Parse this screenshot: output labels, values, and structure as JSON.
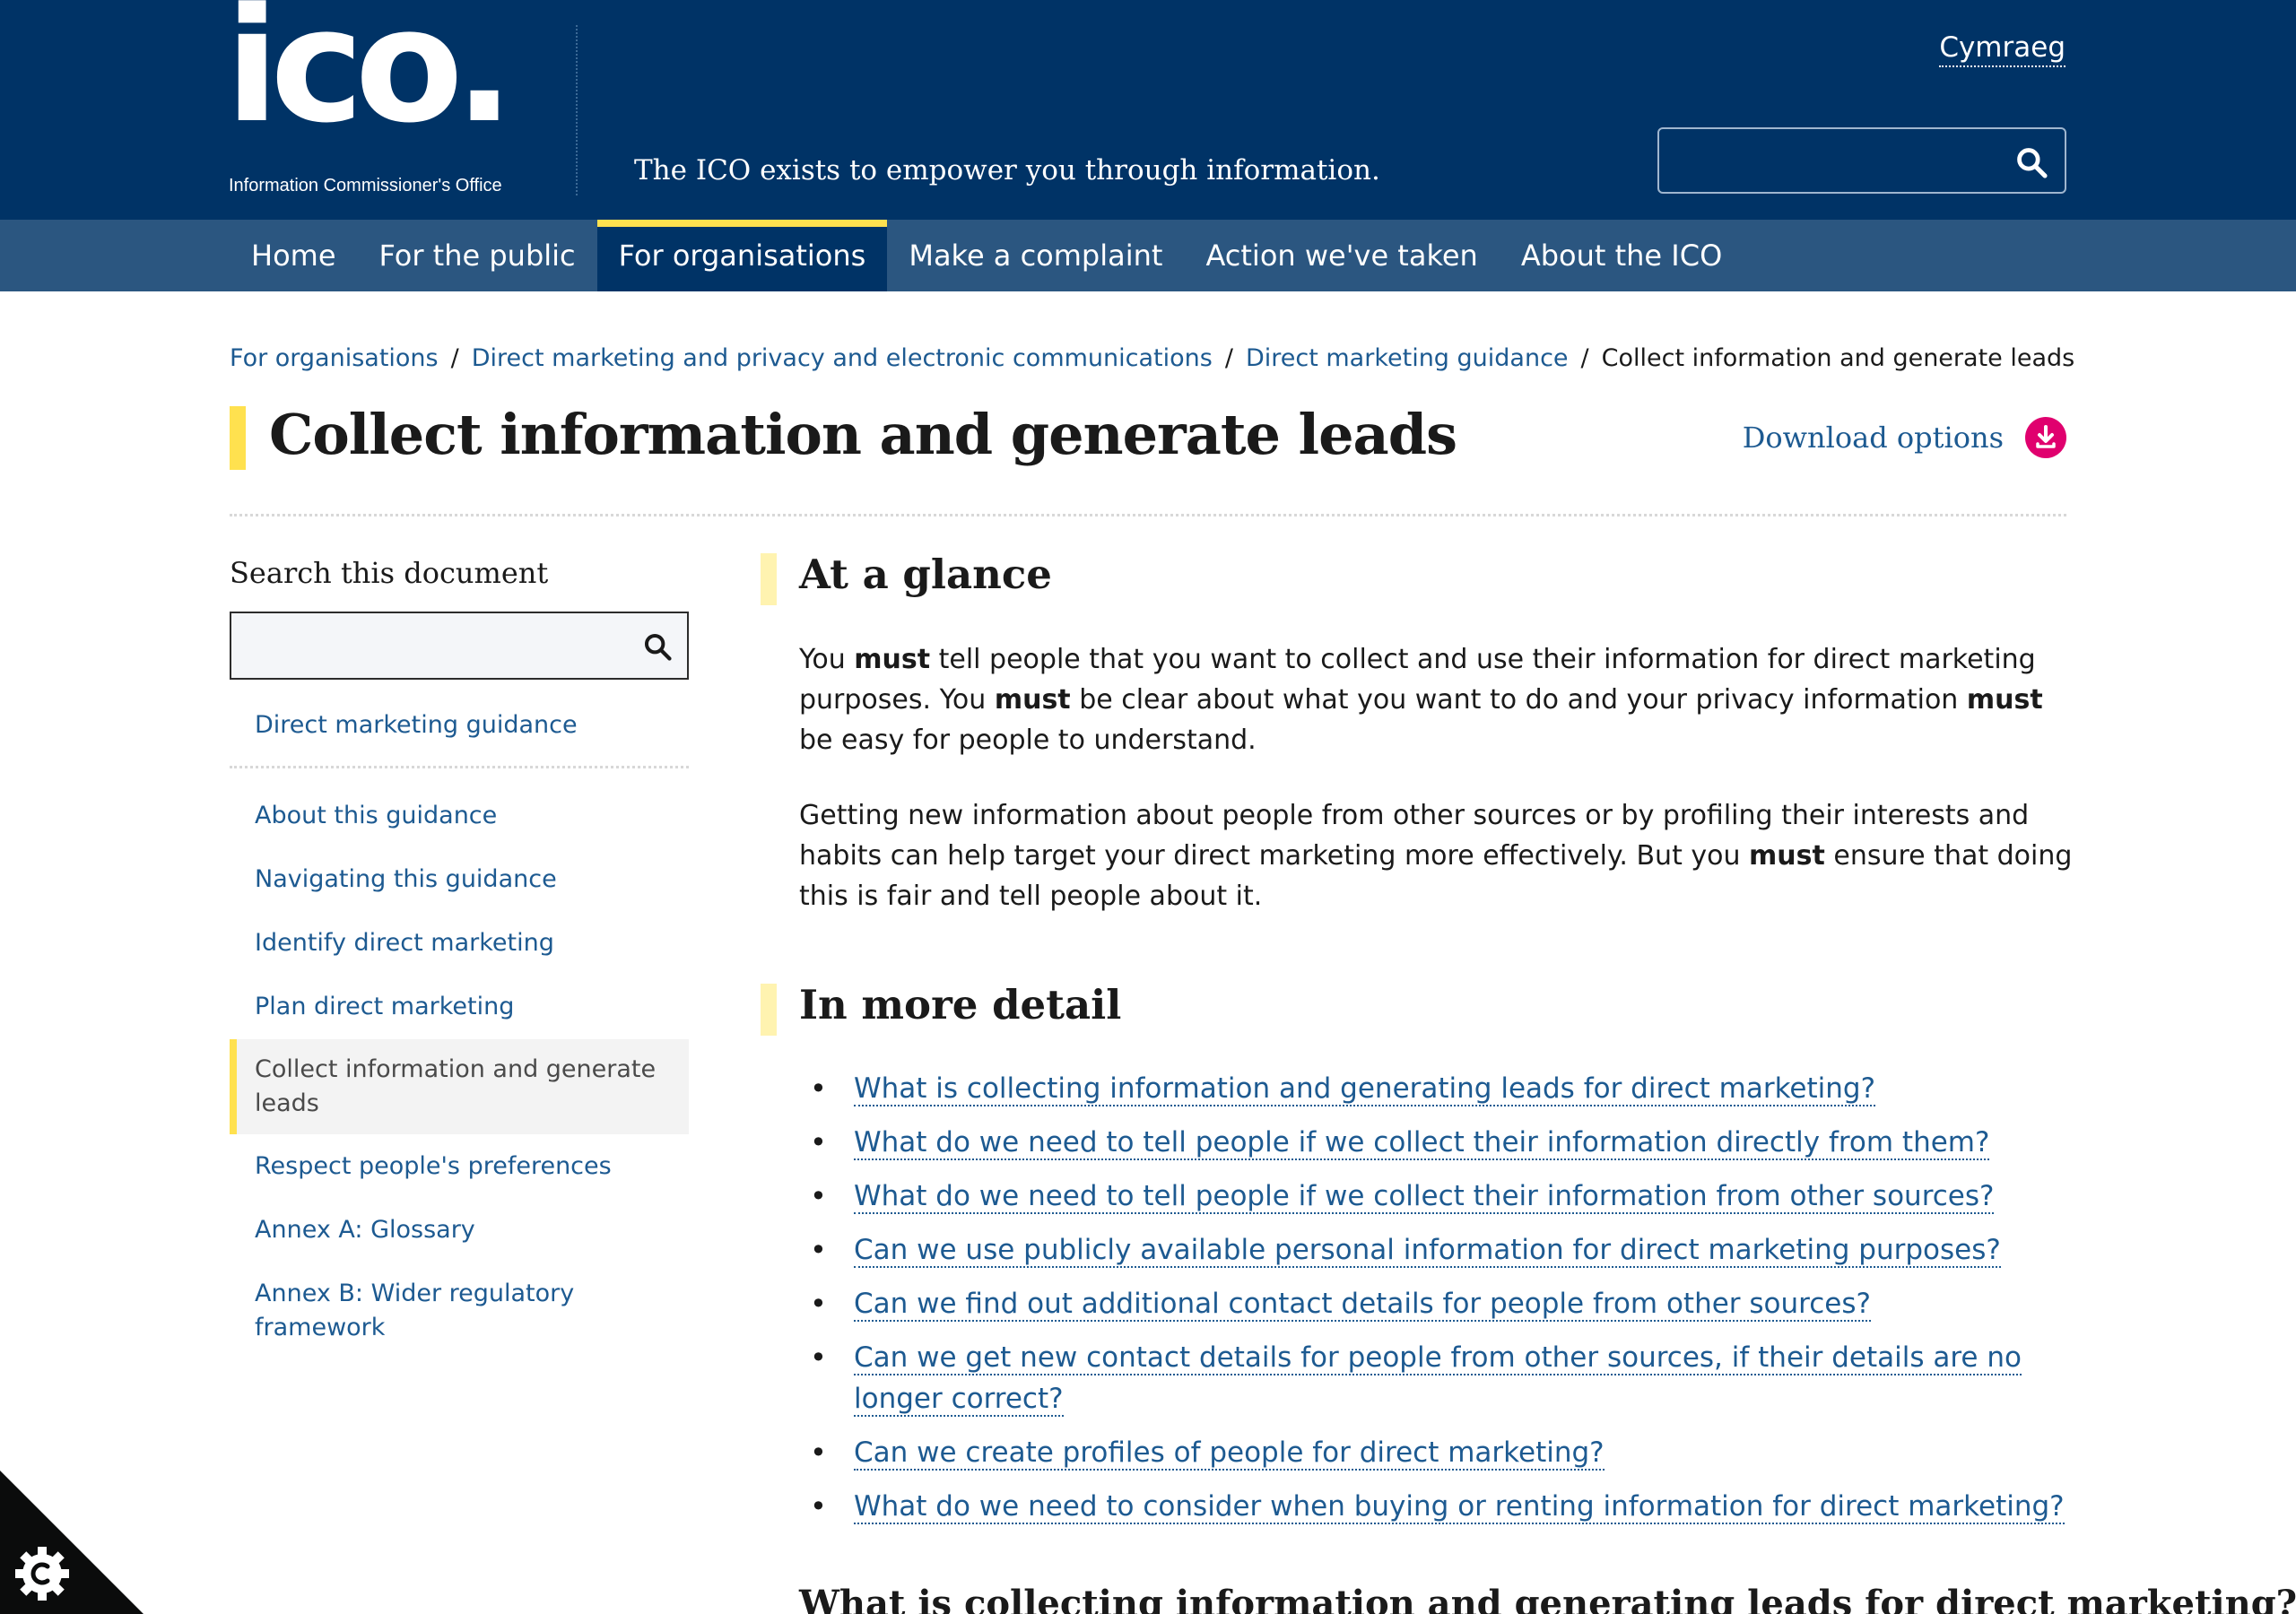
{
  "header": {
    "logo_text": "ico.",
    "logo_sub": "Information Commissioner's Office",
    "tagline": "The ICO exists to empower you through information.",
    "language_link": "Cymraeg",
    "search_value": ""
  },
  "nav": {
    "items": [
      {
        "label": "Home",
        "active": false
      },
      {
        "label": "For the public",
        "active": false
      },
      {
        "label": "For organisations",
        "active": true
      },
      {
        "label": "Make a complaint",
        "active": false
      },
      {
        "label": "Action we've taken",
        "active": false
      },
      {
        "label": "About the ICO",
        "active": false
      }
    ]
  },
  "breadcrumb": {
    "items": [
      "For organisations",
      "Direct marketing and privacy and electronic communications",
      "Direct marketing guidance"
    ],
    "separator": "/",
    "current": "Collect information and generate leads"
  },
  "page": {
    "title": "Collect information and generate leads",
    "download_label": "Download options"
  },
  "sidebar": {
    "search_heading": "Search this document",
    "search_value": "",
    "top_item": "Direct marketing guidance",
    "items": [
      "About this guidance",
      "Navigating this guidance",
      "Identify direct marketing",
      "Plan direct marketing",
      "Collect information and generate leads",
      "Respect people's preferences",
      "Annex A: Glossary",
      "Annex B: Wider regulatory framework"
    ],
    "current_item": "Collect information and generate leads"
  },
  "main": {
    "glance_title": "At a glance",
    "p1": {
      "a": "You ",
      "b1": "must",
      "c": " tell people that you want to collect and use their information for direct marketing purposes. You ",
      "b2": "must",
      "d": " be clear about what you want to do and your privacy information ",
      "b3": "must",
      "e": " be easy for people to understand."
    },
    "p2": {
      "a": "Getting new information about people from other sources or by profiling their interests and habits can help target your direct marketing more effectively. But you ",
      "b1": "must",
      "c": " ensure that doing this is fair and tell people about it."
    },
    "detail_title": "In more detail",
    "questions": [
      "What is collecting information and generating leads for direct marketing?",
      "What do we need to tell people if we collect their information directly from them?",
      "What do we need to tell people if we collect their information from other sources?",
      "Can we use publicly available personal information for direct marketing purposes?",
      "Can we find out additional contact details for people from other sources?",
      "Can we get new contact details for people from other sources, if their details are no longer correct?",
      "Can we create profiles of people for direct marketing?",
      "What do we need to consider when buying or renting information for direct marketing?"
    ],
    "next_heading": "What is collecting information and generating leads for direct marketing?"
  },
  "icons": {
    "search": "search-icon",
    "download": "download-icon",
    "cookie": "cookie-settings-icon"
  },
  "colors": {
    "header_bg": "#003366",
    "nav_bg": "#2b5680",
    "accent_yellow": "#ffe14f",
    "link": "#1d5a91",
    "download_pink": "#e0006e"
  }
}
